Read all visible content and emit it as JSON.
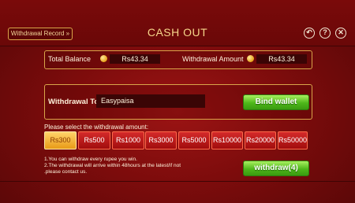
{
  "header": {
    "record_label": "Withdrawal Record »",
    "title": "CASH OUT"
  },
  "icons": {
    "back": "back-icon",
    "help": "help-icon",
    "close": "close-icon",
    "coin": "coin-icon"
  },
  "balance": {
    "total_label": "Total Balance",
    "total_value": "Rs43.34",
    "withdrawal_label": "Withdrawal Amount",
    "withdrawal_value": "Rs43.34"
  },
  "method": {
    "label": "Withdrawal To",
    "value": "Easypaisa",
    "bind_label": "Bind wallet"
  },
  "amounts": {
    "prompt": "Please select the withdrawal amount:",
    "options": [
      "Rs300",
      "Rs500",
      "Rs1000",
      "Rs3000",
      "Rs5000",
      "Rs10000",
      "Rs20000",
      "Rs50000"
    ],
    "selected": "Rs300"
  },
  "notes": {
    "line1": "1.You can withdraw every rupee you win.",
    "line2": "2.The withdrawal will arrive within 48hours at the latest/if not",
    "line3": ".please contact us."
  },
  "withdraw_button": "withdraw(4)",
  "colors": {
    "accent_gold": "#d9a54a",
    "button_green": "#4eb81a",
    "amount_red": "#c41c1c",
    "amount_selected": "#f2b23c"
  }
}
